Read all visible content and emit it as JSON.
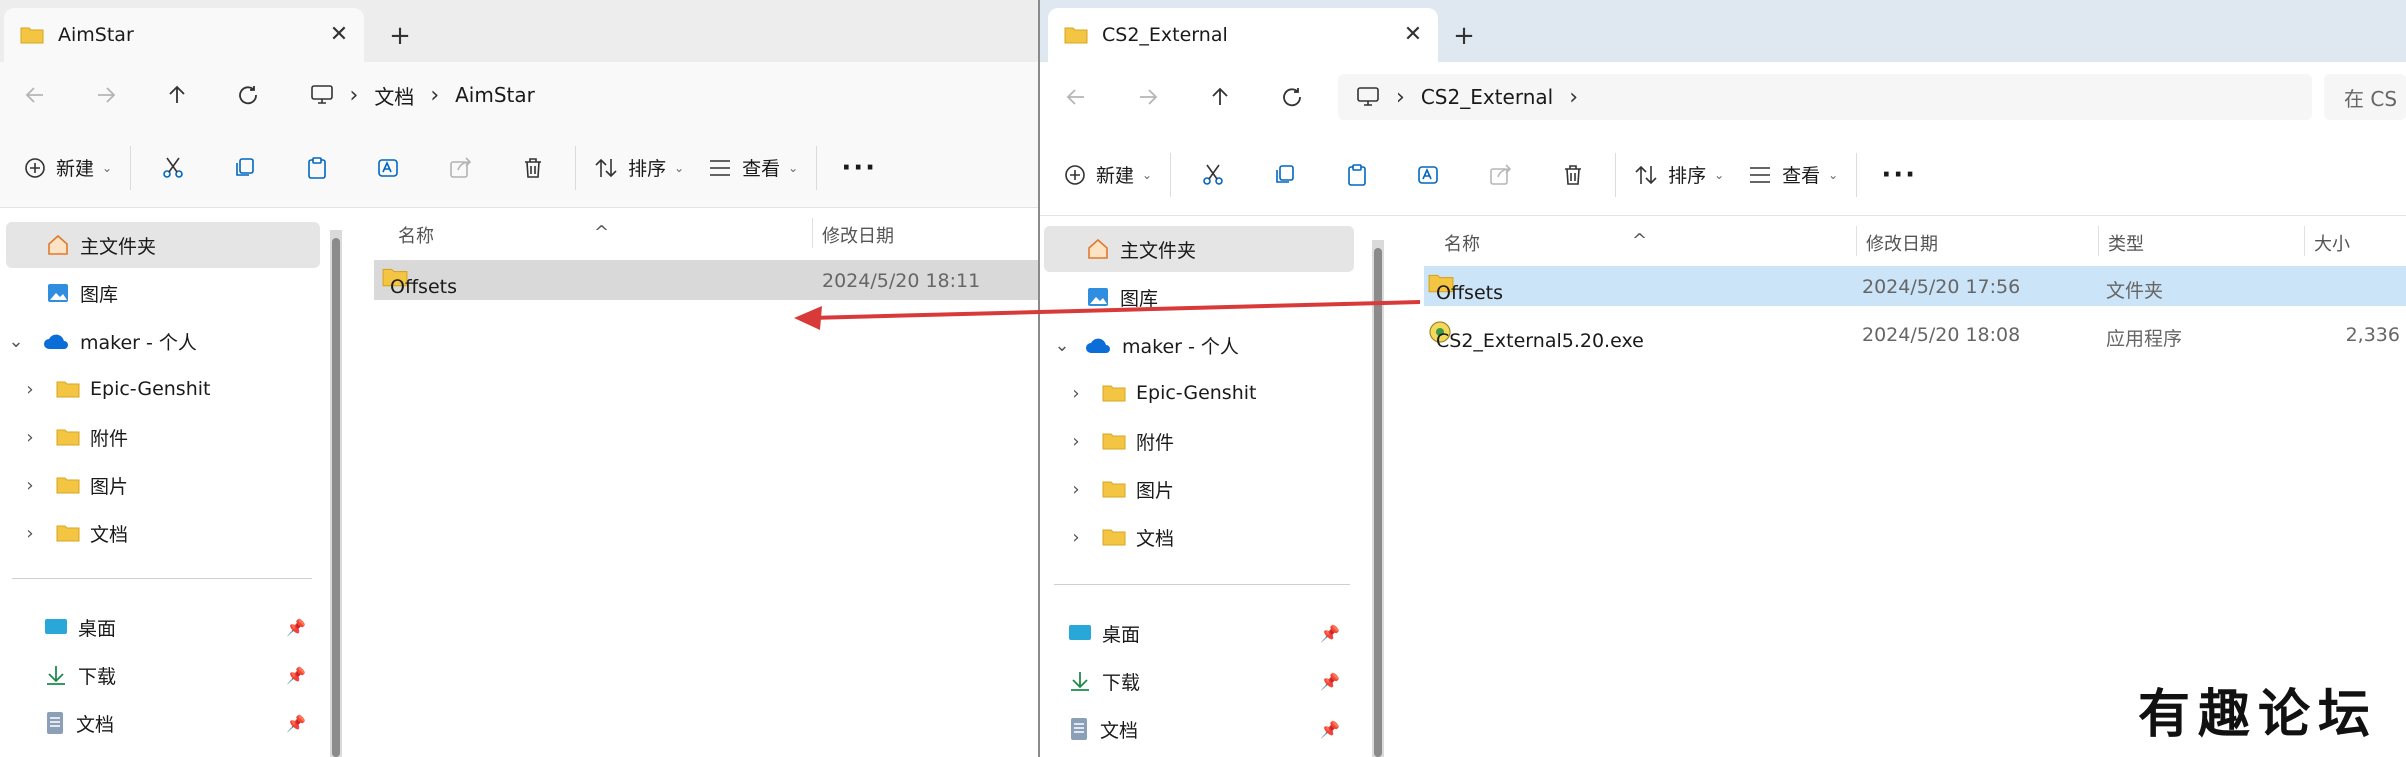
{
  "left_window": {
    "tab_title": "AimStar",
    "address": {
      "segments": [
        "文档",
        "AimStar"
      ]
    },
    "toolbar": {
      "new_label": "新建",
      "sort_label": "排序",
      "view_label": "查看"
    },
    "sidebar": {
      "home": "主文件夹",
      "gallery": "图库",
      "cloud": "maker - 个人",
      "folders": [
        "Epic-Genshit",
        "附件",
        "图片",
        "文档"
      ],
      "quick": [
        "桌面",
        "下载",
        "文档"
      ]
    },
    "columns": {
      "name": "名称",
      "modified": "修改日期"
    },
    "rows": [
      {
        "name": "Offsets",
        "modified": "2024/5/20 18:11"
      }
    ]
  },
  "right_window": {
    "tab_title": "CS2_External",
    "address": {
      "segments": [
        "CS2_External"
      ]
    },
    "search_placeholder": "在 CS",
    "toolbar": {
      "new_label": "新建",
      "sort_label": "排序",
      "view_label": "查看"
    },
    "sidebar": {
      "home": "主文件夹",
      "gallery": "图库",
      "cloud": "maker - 个人",
      "folders": [
        "Epic-Genshit",
        "附件",
        "图片",
        "文档"
      ],
      "quick": [
        "桌面",
        "下载",
        "文档"
      ]
    },
    "columns": {
      "name": "名称",
      "modified": "修改日期",
      "type": "类型",
      "size": "大小"
    },
    "rows": [
      {
        "name": "Offsets",
        "modified": "2024/5/20 17:56",
        "type": "文件夹",
        "size": ""
      },
      {
        "name": "CS2_External5.20.exe",
        "modified": "2024/5/20 18:08",
        "type": "应用程序",
        "size": "2,336"
      }
    ]
  },
  "watermark": "有趣论坛",
  "colors": {
    "accent": "#0067c0",
    "selection": "#cce4f7",
    "arrow": "#d83a3a",
    "folder": "#f4c542"
  }
}
